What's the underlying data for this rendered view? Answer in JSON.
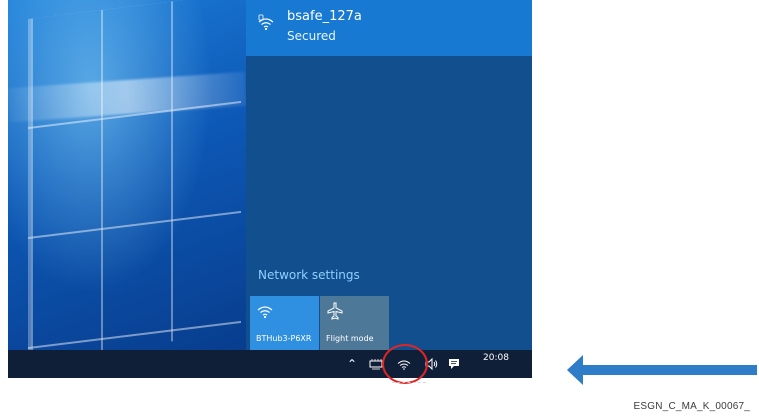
{
  "network": {
    "name": "bsafe_127a",
    "status": "Secured"
  },
  "flyout": {
    "settings_label": "Network settings",
    "tiles": [
      {
        "label": "BTHub3-P6XR",
        "icon": "wifi-icon"
      },
      {
        "label": "Flight mode",
        "icon": "airplane-icon"
      }
    ]
  },
  "taskbar": {
    "time": "20:08",
    "icons": [
      "show-hidden-icons-icon",
      "input-indicator-icon",
      "wifi-icon",
      "volume-icon",
      "notification-icon"
    ]
  },
  "annotation": {
    "caption": "ESGN_C_MA_K_00067_"
  },
  "colors": {
    "flyout_background": "#124f8f",
    "selected_network": "#1779d1",
    "network_settings_link": "#8ed0ff",
    "highlight_ring": "#df2525",
    "arrow": "#2f7cc9"
  }
}
